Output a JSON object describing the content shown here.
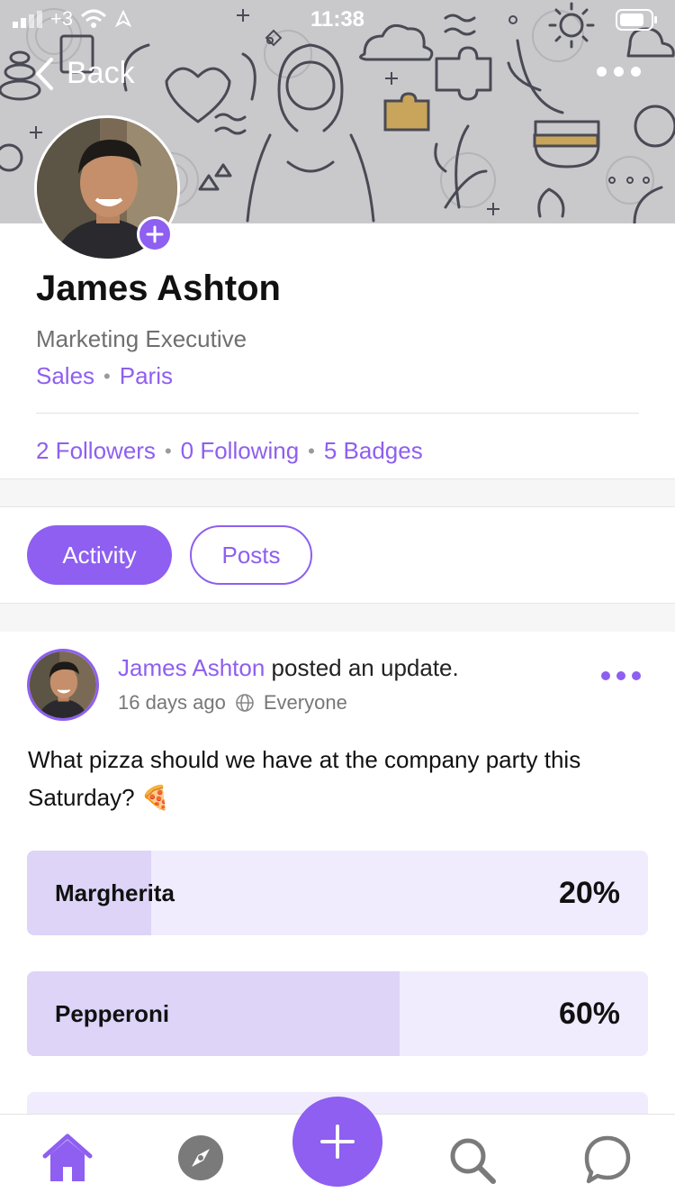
{
  "status_bar": {
    "carrier": "+3",
    "time": "11:38"
  },
  "header": {
    "back_label": "Back"
  },
  "profile": {
    "name": "James Ashton",
    "job_title": "Marketing Executive",
    "department": "Sales",
    "location": "Paris",
    "followers": "2 Followers",
    "following": "0 Following",
    "badges": "5 Badges"
  },
  "tabs": [
    {
      "label": "Activity",
      "active": true
    },
    {
      "label": "Posts",
      "active": false
    }
  ],
  "post": {
    "author": "James Ashton",
    "action": "posted an update.",
    "time_ago": "16 days ago",
    "visibility": "Everyone",
    "body": "What pizza should we have at the company party this Saturday? 🍕",
    "poll": [
      {
        "label": "Margherita",
        "percent_text": "20%",
        "fraction": 0.2
      },
      {
        "label": "Pepperoni",
        "percent_text": "60%",
        "fraction": 0.6
      }
    ]
  },
  "theme": {
    "accent": "#8e5ff0",
    "poll_bg": "#f0ecfd",
    "poll_fill": "#ddd4f8"
  },
  "bottom_nav": [
    "home-icon",
    "compass-icon",
    "plus-icon",
    "search-icon",
    "chat-bubble-icon"
  ]
}
